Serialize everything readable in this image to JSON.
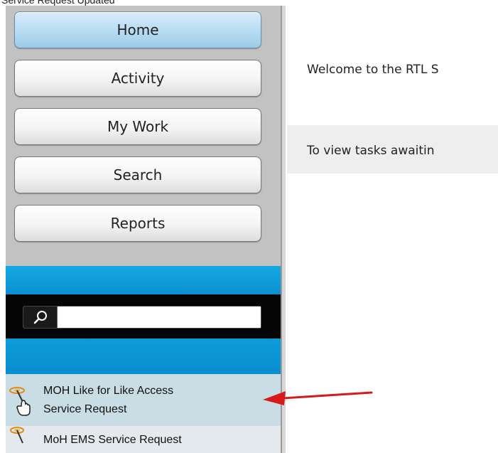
{
  "top_clipped_text": "Service Request Updated",
  "nav": {
    "buttons": [
      {
        "label": "Home",
        "active": true
      },
      {
        "label": "Activity",
        "active": false
      },
      {
        "label": "My Work",
        "active": false
      },
      {
        "label": "Search",
        "active": false
      },
      {
        "label": "Reports",
        "active": false
      }
    ]
  },
  "search": {
    "icon": "search-icon",
    "value": "",
    "placeholder": ""
  },
  "request_list": {
    "items": [
      {
        "label_line1": "MOH Like for Like Access",
        "label_line2": "Service Request",
        "icon": "service-request-icon"
      },
      {
        "label_line1": "MoH EMS Service Request",
        "label_line2": "",
        "icon": "service-request-icon"
      }
    ]
  },
  "main": {
    "welcome_text": "Welcome to the RTL S",
    "info_text": "To view tasks awaitin"
  },
  "annotation": {
    "arrow_color": "#d81a1a"
  },
  "colors": {
    "sidebar_bg": "#c2c2c2",
    "active_button": "#b7dbf2",
    "blue_band": "#0a8fd0",
    "selected_item": "#c9dde4"
  }
}
